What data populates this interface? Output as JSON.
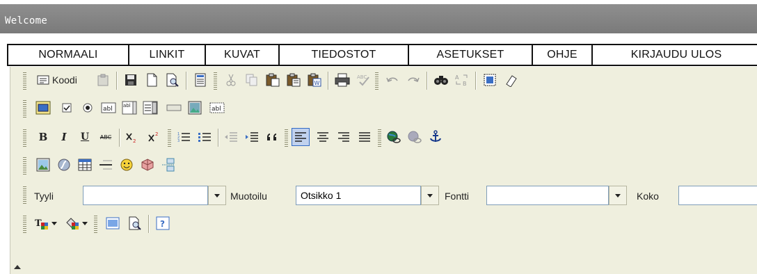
{
  "window": {
    "title": "Welcome"
  },
  "menu": {
    "items": [
      {
        "label": "NORMAALI"
      },
      {
        "label": "LINKIT"
      },
      {
        "label": "KUVAT"
      },
      {
        "label": "TIEDOSTOT"
      },
      {
        "label": "ASETUKSET"
      },
      {
        "label": "OHJE"
      },
      {
        "label": "KIRJAUDU ULOS"
      }
    ]
  },
  "toolbar": {
    "source_label": "Koodi",
    "style_label": "Tyyli",
    "style_value": "",
    "format_label": "Muotoilu",
    "format_value": "Otsikko 1",
    "font_label": "Fontti",
    "font_value": "",
    "size_label": "Koko",
    "size_value": "",
    "icons": {
      "textfield_label": "abl",
      "textarea_label": "abl",
      "hidden_label": "abl",
      "spellcheck_label": "ABC",
      "strike_label": "ABC",
      "bold_label": "B",
      "italic_label": "I",
      "underline_label": "U"
    }
  },
  "colors": {
    "titlebar": "#858585",
    "toolbar_bg": "#efefde",
    "active_button": "#c1d2ee"
  }
}
